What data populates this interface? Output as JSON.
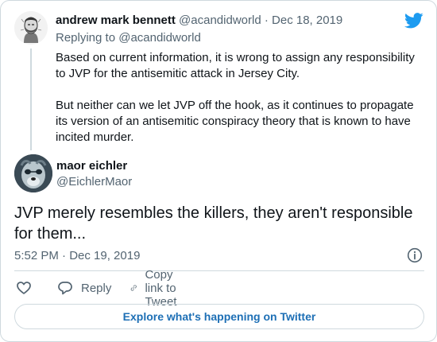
{
  "reply_tweet": {
    "author_name": "andrew mark bennett",
    "author_handle": "@acandidworld",
    "separator": "·",
    "date": "Dec 18, 2019",
    "replying_to": "Replying to @acandidworld",
    "paragraphs": [
      "Based on current information, it is wrong to assign any responsibility to JVP for the antisemitic attack in Jersey City.",
      "But neither can we let JVP off the hook, as it continues to propagate its version of an antisemitic conspiracy theory that is known to have incited murder."
    ]
  },
  "main_tweet": {
    "author_name": "maor eichler",
    "author_handle": "@EichlerMaor",
    "text": "JVP merely resembles the killers, they aren't responsible for them...",
    "timestamp": "5:52 PM · Dec 19, 2019"
  },
  "actions": {
    "like_icon": "heart-icon",
    "reply_label": "Reply",
    "reply_icon": "speech-bubble-icon",
    "copy_link_label": "Copy link to Tweet",
    "copy_link_icon": "link-icon"
  },
  "explore_button": "Explore what's happening on Twitter",
  "icons": [
    "twitter-bird-icon",
    "info-icon"
  ],
  "colors": {
    "twitter_blue": "#1d9bf0",
    "link_blue": "#1d6fb5",
    "text": "#0f1419",
    "muted": "#536471",
    "border": "#cfd9de"
  }
}
